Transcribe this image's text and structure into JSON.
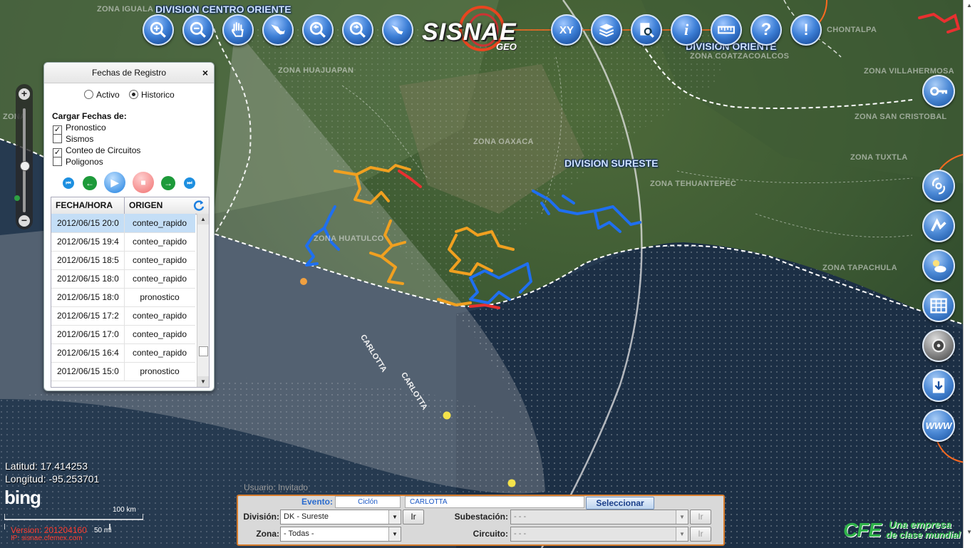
{
  "toolbar": {
    "buttons": [
      {
        "name": "zoom-in-icon",
        "label": ""
      },
      {
        "name": "zoom-out-icon",
        "label": ""
      },
      {
        "name": "pan-hand-icon",
        "label": ""
      },
      {
        "name": "mexico-map-icon",
        "label": ""
      },
      {
        "name": "zoom-previous-icon",
        "label": ""
      },
      {
        "name": "zoom-next-icon",
        "label": ""
      },
      {
        "name": "map-region-icon",
        "label": ""
      }
    ],
    "buttons_right": [
      {
        "name": "xy-coordinates-button",
        "label": "XY"
      },
      {
        "name": "layers-icon",
        "label": ""
      },
      {
        "name": "search-document-icon",
        "label": ""
      },
      {
        "name": "info-icon",
        "label": "i"
      },
      {
        "name": "ruler-icon",
        "label": ""
      },
      {
        "name": "help-icon",
        "label": "?"
      },
      {
        "name": "alert-icon",
        "label": "!"
      }
    ],
    "logo_text": "SISNAE",
    "logo_sub": "GEO"
  },
  "map": {
    "division_labels": {
      "centro_oriente": "DIVISION CENTRO ORIENTE",
      "oriente": "DIVISION ORIENTE",
      "sureste": "DIVISION SURESTE"
    },
    "zone_labels": {
      "iguala": "ZONA IGUALA",
      "huajuapan": "ZONA HUAJUAPAN",
      "coatzacoalcos": "ZONA COATZACOALCOS",
      "villahermosa": "ZONA VILLAHERMOSA",
      "chontalpa": "CHONTALPA",
      "oaxaca": "ZONA OAXACA",
      "san_cristobal": "ZONA SAN CRISTOBAL",
      "tuxtla": "ZONA TUXTLA",
      "tehuantepec": "ZONA TEHUANTEPEC",
      "huatulco": "ZONA HUATULCO",
      "tapachula": "ZONA TAPACHULA",
      "z": "ZONA"
    },
    "storm_labels": [
      "CARLOTTA",
      "CARLOTTA"
    ],
    "colors": {
      "conteo": "#f0a020",
      "pronostico_blue": "#1f6ff0",
      "red": "#e83030",
      "storm_dot": "#f4e24a",
      "storm_dot_orange": "#f0a040"
    }
  },
  "panel": {
    "title": "Fechas de Registro",
    "close": "×",
    "radio_activo": "Activo",
    "radio_historico": "Historico",
    "cargar_label": "Cargar Fechas de:",
    "checks": [
      {
        "label": "Pronostico",
        "checked": true
      },
      {
        "label": "Sismos",
        "checked": false
      },
      {
        "label": "Conteo de Circuitos",
        "checked": true
      },
      {
        "label": "Poligonos",
        "checked": false
      }
    ],
    "grid": {
      "headers": [
        "FECHA/HORA",
        "ORIGEN"
      ],
      "rows": [
        {
          "fecha": "2012/06/15 20:0",
          "origen": "conteo_rapido",
          "selected": true
        },
        {
          "fecha": "2012/06/15 19:4",
          "origen": "conteo_rapido"
        },
        {
          "fecha": "2012/06/15 18:5",
          "origen": "conteo_rapido"
        },
        {
          "fecha": "2012/06/15 18:0",
          "origen": "conteo_rapido"
        },
        {
          "fecha": "2012/06/15 18:0",
          "origen": "pronostico"
        },
        {
          "fecha": "2012/06/15 17:2",
          "origen": "conteo_rapido"
        },
        {
          "fecha": "2012/06/15 17:0",
          "origen": "conteo_rapido"
        },
        {
          "fecha": "2012/06/15 16:4",
          "origen": "conteo_rapido"
        },
        {
          "fecha": "2012/06/15 15:0",
          "origen": "pronostico"
        }
      ]
    }
  },
  "coords": {
    "latitud": "Latitud: 17.414253",
    "longitud": "Longitud: -95.253701"
  },
  "bing": "bing",
  "scale": {
    "km": "100 km",
    "mi": "50 mi"
  },
  "version": "Version: 201204160",
  "ip": "IP: sisnae.cfemex.com",
  "form": {
    "usuario": "Usuario: Invitado",
    "evento_label": "Evento:",
    "evento_tipo": "Ciclón",
    "evento_nombre": "CARLOTTA",
    "seleccionar": "Seleccionar",
    "division_label": "División:",
    "division_value": "DK - Sureste",
    "zona_label": "Zona:",
    "zona_value": "- Todas -",
    "ir": "Ir",
    "subestacion_label": "Subestación:",
    "subestacion_value": "- - -",
    "circuito_label": "Circuito:",
    "circuito_value": "- - -"
  },
  "cfe": {
    "logo": "CFE",
    "tag1": "Una empresa",
    "tag2": "de clase mundial"
  }
}
